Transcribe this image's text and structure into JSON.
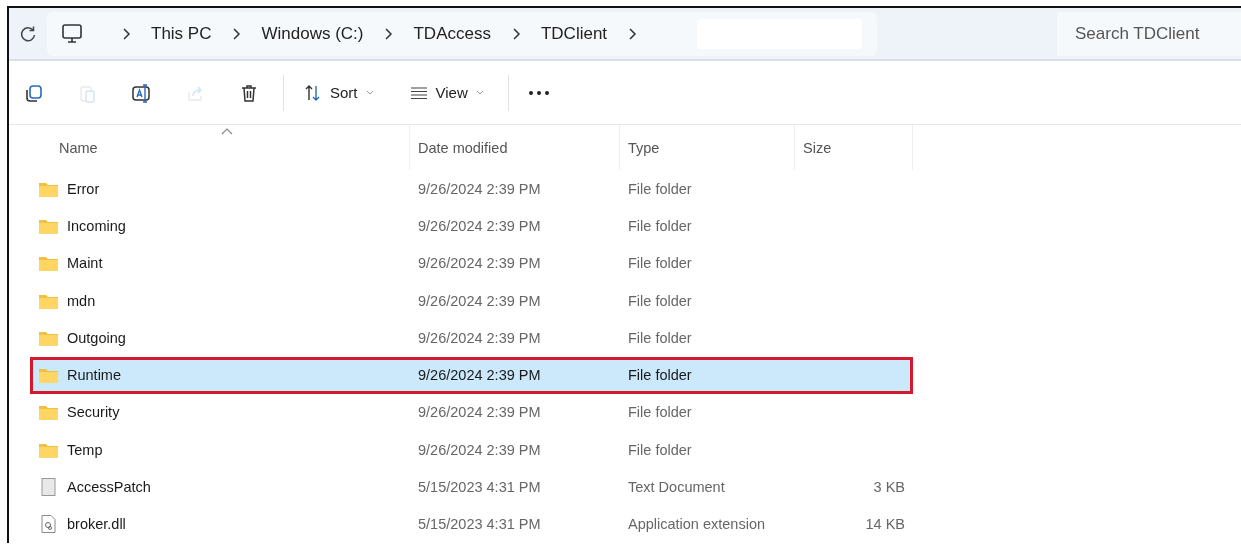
{
  "address_bar": {
    "crumbs": [
      "This PC",
      "Windows (C:)",
      "TDAccess",
      "TDClient"
    ],
    "search": {
      "placeholder": "Search TDClient"
    }
  },
  "toolbar": {
    "icon_buttons": [
      {
        "kind": "copy",
        "disabled": false
      },
      {
        "kind": "paste",
        "disabled": true
      },
      {
        "kind": "rename",
        "disabled": false
      },
      {
        "kind": "share",
        "disabled": true
      },
      {
        "kind": "delete",
        "disabled": false
      }
    ],
    "sort": "Sort",
    "view": "View"
  },
  "table": {
    "columns": [
      "Name",
      "Date modified",
      "Type",
      "Size"
    ],
    "rows": [
      {
        "kind": "folder",
        "name": "Error",
        "date": "9/26/2024 2:39 PM",
        "type": "File folder",
        "selected": false
      },
      {
        "kind": "folder",
        "name": "Incoming",
        "date": "9/26/2024 2:39 PM",
        "type": "File folder",
        "selected": false
      },
      {
        "kind": "folder",
        "name": "Maint",
        "date": "9/26/2024 2:39 PM",
        "type": "File folder",
        "selected": false
      },
      {
        "kind": "folder",
        "name": "mdn",
        "date": "9/26/2024 2:39 PM",
        "type": "File folder",
        "selected": false
      },
      {
        "kind": "folder",
        "name": "Outgoing",
        "date": "9/26/2024 2:39 PM",
        "type": "File folder",
        "selected": false
      },
      {
        "kind": "folder",
        "name": "Runtime",
        "date": "9/26/2024 2:39 PM",
        "type": "File folder",
        "selected": true
      },
      {
        "kind": "folder",
        "name": "Security",
        "date": "9/26/2024 2:39 PM",
        "type": "File folder",
        "selected": false
      },
      {
        "kind": "folder",
        "name": "Temp",
        "date": "9/26/2024 2:39 PM",
        "type": "File folder",
        "selected": false
      },
      {
        "kind": "text",
        "name": "AccessPatch",
        "date": "5/15/2023 4:31 PM",
        "type": "Text Document",
        "size": "3 KB",
        "selected": false
      },
      {
        "kind": "dll",
        "name": "broker.dll",
        "date": "5/15/2023 4:31 PM",
        "type": "Application extension",
        "size": "14 KB",
        "selected": false
      }
    ]
  }
}
